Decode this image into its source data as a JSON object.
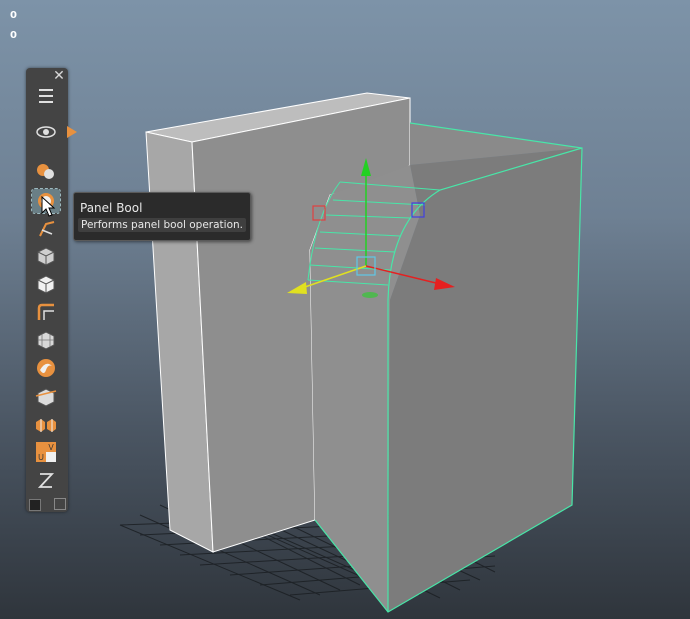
{
  "hud": {
    "line1": "0",
    "line2": "0"
  },
  "toolbar": {
    "close_label": "✕",
    "tools": [
      {
        "name": "menu-icon"
      },
      {
        "name": "eye-icon"
      },
      {
        "name": "primitives-icon"
      },
      {
        "name": "panel-bool-icon"
      },
      {
        "name": "bevel-icon"
      },
      {
        "name": "cut-box-icon"
      },
      {
        "name": "cube-icon"
      },
      {
        "name": "corner-icon"
      },
      {
        "name": "grid-cube-icon"
      },
      {
        "name": "swirl-icon"
      },
      {
        "name": "slice-cube-icon"
      },
      {
        "name": "split-cubes-icon"
      },
      {
        "name": "uv-icon"
      },
      {
        "name": "curve-icon"
      }
    ],
    "uv_label_u": "U",
    "uv_label_v": "V"
  },
  "tooltip": {
    "title": "Panel Bool",
    "description": "Performs panel bool operation."
  },
  "colors": {
    "accent_orange": "#e8913f",
    "selection_green": "#48e6a8",
    "axis_x": "#e52020",
    "axis_y": "#22d022",
    "axis_z": "#e0e020"
  }
}
